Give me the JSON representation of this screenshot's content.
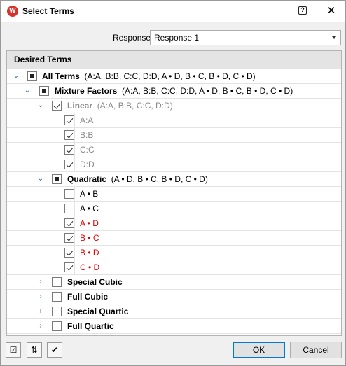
{
  "window": {
    "title": "Select Terms",
    "app_icon": "W"
  },
  "response": {
    "label": "Response",
    "value": "Response 1"
  },
  "group": {
    "title": "Desired Terms"
  },
  "tree": {
    "all": {
      "name": "All Terms",
      "terms": "(A:A, B:B, C:C, D:D, A • D, B • C, B • D, C • D)"
    },
    "mixture": {
      "name": "Mixture Factors",
      "terms": "(A:A, B:B, C:C, D:D, A • D, B • C, B • D, C • D)"
    },
    "linear": {
      "name": "Linear",
      "terms": "(A:A, B:B, C:C, D:D)",
      "items": [
        "A:A",
        "B:B",
        "C:C",
        "D:D"
      ]
    },
    "quadratic": {
      "name": "Quadratic",
      "terms": "(A • D, B • C, B • D, C • D)",
      "items": [
        "A • B",
        "A • C",
        "A • D",
        "B • C",
        "B • D",
        "C • D"
      ]
    },
    "special_cubic": {
      "name": "Special Cubic"
    },
    "full_cubic": {
      "name": "Full Cubic"
    },
    "special_quartic": {
      "name": "Special Quartic"
    },
    "full_quartic": {
      "name": "Full Quartic"
    }
  },
  "buttons": {
    "ok": "OK",
    "cancel": "Cancel"
  },
  "colors": {
    "selected_term": "#e00000",
    "disabled_term": "#888888"
  }
}
